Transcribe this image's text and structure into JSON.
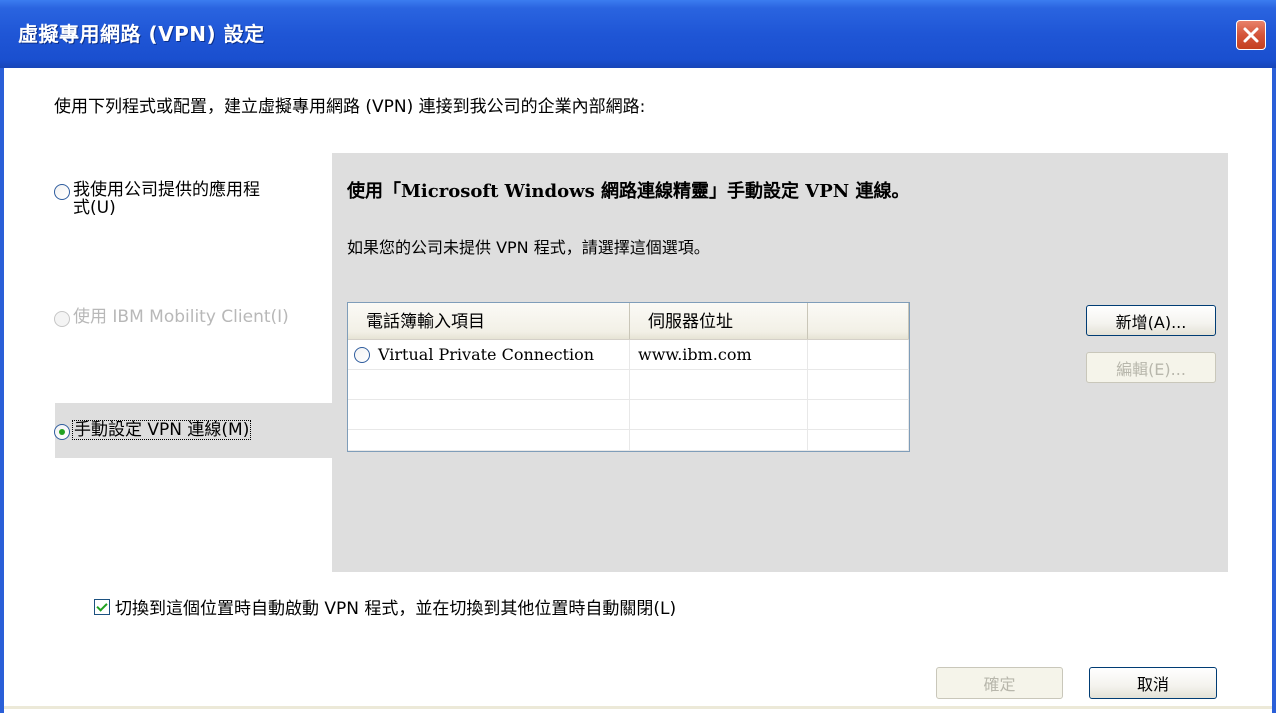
{
  "window": {
    "title": "虛擬專用網路 (VPN) 設定",
    "close_icon": "close-icon",
    "accent_color": "#2a5fd8",
    "close_color": "#d4553a"
  },
  "intro_text": "使用下列程式或配置，建立虛擬專用網路 (VPN) 連接到我公司的企業內部網路:",
  "options": [
    {
      "line1": "我使用公司提供的應用程",
      "line2": "式(U)",
      "checked": false,
      "enabled": true
    },
    {
      "label": "使用 IBM Mobility Client(I)",
      "checked": false,
      "enabled": false
    },
    {
      "label": "手動設定 VPN 連線(M)",
      "checked": true,
      "enabled": true
    }
  ],
  "panel": {
    "heading": "使用「Microsoft Windows 網路連線精靈」手動設定 VPN 連線。",
    "description": "如果您的公司未提供 VPN 程式，請選擇這個選項。"
  },
  "table": {
    "columns": [
      "電話簿輸入項目",
      "伺服器位址",
      ""
    ],
    "rows": [
      {
        "name": "Virtual Private Connection",
        "server": "www.ibm.com"
      }
    ]
  },
  "buttons": {
    "add": "新增(A)...",
    "edit": "編輯(E)...",
    "ok": "確定",
    "cancel": "取消"
  },
  "auto_start": {
    "label": "切換到這個位置時自動啟動 VPN 程式，並在切換到其他位置時自動關閉(L)",
    "checked": true
  }
}
